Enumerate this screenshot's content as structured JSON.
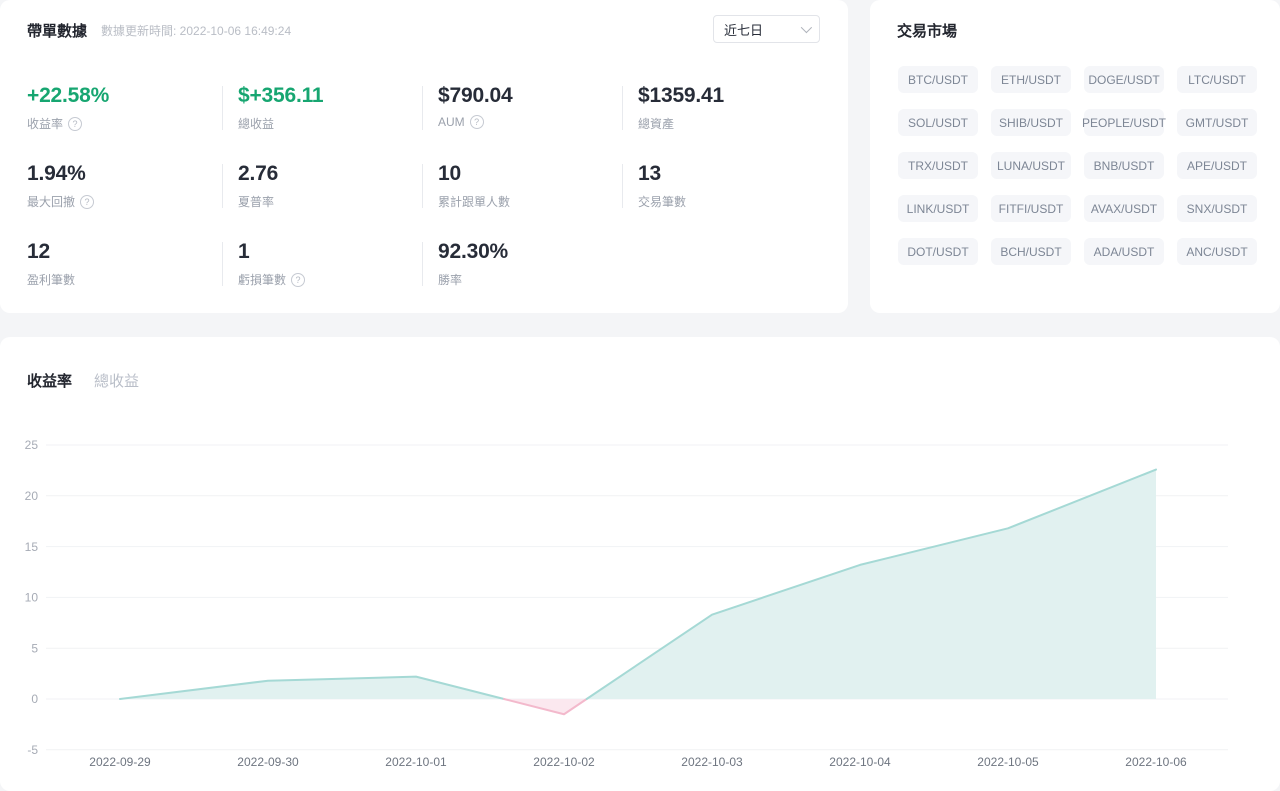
{
  "stats_panel": {
    "title": "帶單數據",
    "update_time": "數據更新時間: 2022-10-06 16:49:24",
    "period_select": {
      "value": "近七日"
    },
    "stats": [
      {
        "value": "+22.58%",
        "label": "收益率",
        "help": true,
        "color": "green"
      },
      {
        "value": "$+356.11",
        "label": "總收益",
        "help": false,
        "color": "green"
      },
      {
        "value": "$790.04",
        "label": "AUM",
        "help": true,
        "color": "dark"
      },
      {
        "value": "$1359.41",
        "label": "總資產",
        "help": false,
        "color": "dark"
      },
      {
        "value": "1.94%",
        "label": "最大回撤",
        "help": true,
        "color": "dark"
      },
      {
        "value": "2.76",
        "label": "夏普率",
        "help": false,
        "color": "dark"
      },
      {
        "value": "10",
        "label": "累計跟單人數",
        "help": false,
        "color": "dark"
      },
      {
        "value": "13",
        "label": "交易筆數",
        "help": false,
        "color": "dark"
      },
      {
        "value": "12",
        "label": "盈利筆數",
        "help": false,
        "color": "dark"
      },
      {
        "value": "1",
        "label": "虧損筆數",
        "help": true,
        "color": "dark"
      },
      {
        "value": "92.30%",
        "label": "勝率",
        "help": false,
        "color": "dark"
      }
    ]
  },
  "markets_panel": {
    "title": "交易市場",
    "pairs": [
      "BTC/USDT",
      "ETH/USDT",
      "DOGE/USDT",
      "LTC/USDT",
      "SOL/USDT",
      "SHIB/USDT",
      "PEOPLE/USDT",
      "GMT/USDT",
      "TRX/USDT",
      "LUNA/USDT",
      "BNB/USDT",
      "APE/USDT",
      "LINK/USDT",
      "FITFI/USDT",
      "AVAX/USDT",
      "SNX/USDT",
      "DOT/USDT",
      "BCH/USDT",
      "ADA/USDT",
      "ANC/USDT"
    ]
  },
  "chart_section": {
    "tabs": [
      {
        "label": "收益率",
        "active": true
      },
      {
        "label": "總收益",
        "active": false
      }
    ]
  },
  "chart_data": {
    "type": "area",
    "title": "收益率",
    "x": [
      "2022-09-29",
      "2022-09-30",
      "2022-10-01",
      "2022-10-02",
      "2022-10-03",
      "2022-10-04",
      "2022-10-05",
      "2022-10-06"
    ],
    "values": [
      0,
      1.8,
      2.2,
      -1.5,
      8.3,
      13.2,
      16.8,
      22.58
    ],
    "ylim": [
      -5,
      25
    ],
    "yticks": [
      25,
      20,
      15,
      10,
      5,
      0,
      -5
    ],
    "grid": true,
    "legend": "none",
    "colors": {
      "positive_line": "#a5d9d5",
      "positive_fill": "#e1f1f0",
      "negative_line": "#f3b9cc",
      "negative_fill": "#fbe8ef",
      "gridline": "#f1f2f4",
      "ytick_text": "#a6abb5",
      "xtick_text": "#6e7580"
    }
  },
  "colors": {
    "green": "#17a671",
    "dark": "#272c38"
  }
}
